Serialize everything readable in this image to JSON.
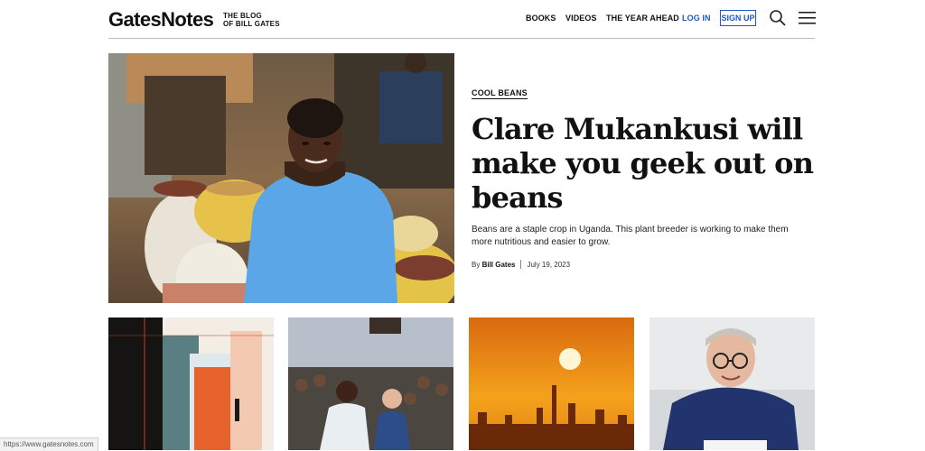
{
  "header": {
    "logo": "GatesNotes",
    "tagline_line1": "THE BLOG",
    "tagline_line2": "OF BILL GATES",
    "nav": {
      "books": "BOOKS",
      "videos": "VIDEOS",
      "year_ahead": "THE YEAR AHEAD",
      "login": "LOG IN",
      "signup": "SIGN UP"
    },
    "icons": [
      "search-icon",
      "hamburger-menu-icon"
    ]
  },
  "hero": {
    "category": "COOL BEANS",
    "headline": "Clare Mukankusi will make you geek out on beans",
    "dek": "Beans are a staple crop in Uganda. This plant breeder is working to make them more nutritious and easier to grow.",
    "by": "By",
    "author": "Bill Gates",
    "date": "July 19, 2023"
  },
  "status_bar": "https://www.gatesnotes.com",
  "colors": {
    "accent_blue": "#1f58c7",
    "text": "#111111",
    "divider": "#bdbdbd"
  }
}
